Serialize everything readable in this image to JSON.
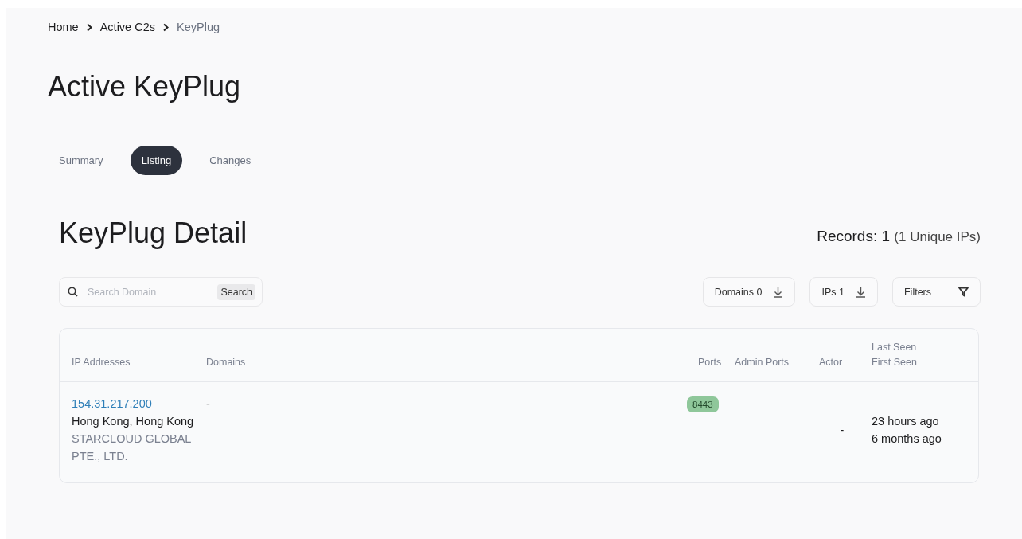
{
  "breadcrumb": [
    {
      "label": "Home",
      "current": false
    },
    {
      "label": "Active C2s",
      "current": false
    },
    {
      "label": "KeyPlug",
      "current": true
    }
  ],
  "page_title": "Active KeyPlug",
  "tabs": [
    {
      "label": "Summary",
      "selected": false
    },
    {
      "label": "Listing",
      "selected": true
    },
    {
      "label": "Changes",
      "selected": false
    }
  ],
  "section_title": "KeyPlug Detail",
  "records": {
    "label": "Records:",
    "count": "1",
    "unique": "(1 Unique IPs)"
  },
  "search": {
    "placeholder": "Search Domain",
    "button": "Search"
  },
  "actions": [
    {
      "label": "Domains 0",
      "kind": "download"
    },
    {
      "label": "IPs 1",
      "kind": "download"
    },
    {
      "label": "Filters",
      "kind": "filter"
    }
  ],
  "table": {
    "columns": [
      {
        "lines": [
          "IP Addresses"
        ]
      },
      {
        "lines": [
          "Domains"
        ]
      },
      {
        "lines": [
          "Ports"
        ]
      },
      {
        "lines": [
          "Admin Ports"
        ]
      },
      {
        "lines": [
          "Actor"
        ]
      },
      {
        "lines": [
          "Last Seen",
          "First Seen"
        ]
      }
    ],
    "rows": [
      {
        "ip": "154.31.217.200",
        "location": "Hong Kong, Hong Kong",
        "organization": "STARCLOUD GLOBAL PTE., LTD.",
        "domains": "-",
        "ports": [
          "8443"
        ],
        "actor": "-",
        "last_seen": "23 hours ago",
        "first_seen": "6 months ago"
      }
    ]
  }
}
